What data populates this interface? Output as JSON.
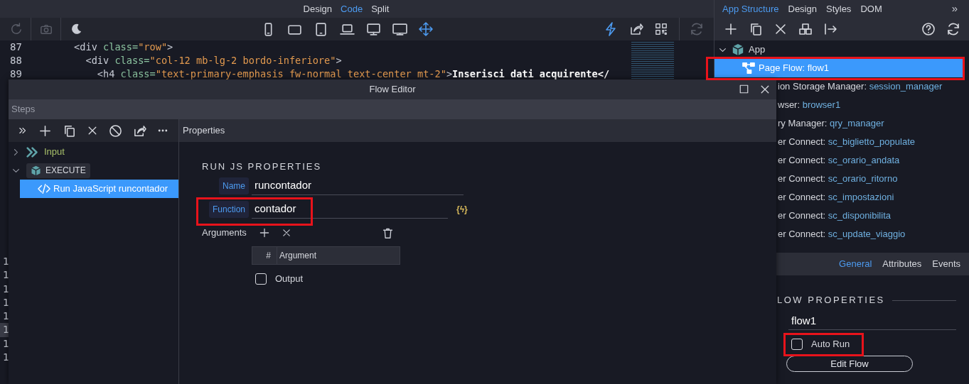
{
  "top_tabs": [
    {
      "label": "Design",
      "selected": false
    },
    {
      "label": "Code",
      "selected": true
    },
    {
      "label": "Split",
      "selected": false
    }
  ],
  "code_editor": {
    "lines": [
      {
        "number": "87",
        "tokens": [
          {
            "kind": "tag",
            "text": "      <div"
          },
          {
            "kind": "attr",
            "text": " class="
          },
          {
            "kind": "string",
            "text": "\"row\""
          },
          {
            "kind": "tag",
            "text": ">"
          }
        ]
      },
      {
        "number": "88",
        "tokens": [
          {
            "kind": "tag",
            "text": "        <div"
          },
          {
            "kind": "attr",
            "text": " class="
          },
          {
            "kind": "string",
            "text": "\"col-12 mb-lg-2 bordo-inferiore\""
          },
          {
            "kind": "tag",
            "text": ">"
          }
        ]
      },
      {
        "number": "89",
        "tokens": [
          {
            "kind": "tag",
            "text": "          <h4"
          },
          {
            "kind": "attr",
            "text": " class="
          },
          {
            "kind": "string",
            "text": "\"text-primary-emphasis fw-normal text-center mt-2\""
          },
          {
            "kind": "tag",
            "text": ">"
          },
          {
            "kind": "text",
            "text": "Inserisci dati acquirente</"
          }
        ]
      }
    ],
    "gutter_fragments": [
      {
        "text": "1",
        "current": false
      },
      {
        "text": "1",
        "current": false
      },
      {
        "text": "1",
        "current": false
      },
      {
        "text": "1",
        "current": false
      },
      {
        "text": "1",
        "current": false
      },
      {
        "text": "1",
        "current": true
      },
      {
        "text": "1",
        "current": false
      },
      {
        "text": "1",
        "current": false
      }
    ]
  },
  "structure_panel": {
    "tabs": [
      {
        "label": "App Structure",
        "selected": true
      },
      {
        "label": "Design",
        "selected": false
      },
      {
        "label": "Styles",
        "selected": false
      },
      {
        "label": "DOM",
        "selected": false
      }
    ],
    "more": "»",
    "tree": {
      "label": "App",
      "expanded": true,
      "children": [
        {
          "kind": "page_flow",
          "label": "Page Flow:",
          "value": "flow1",
          "selected": true
        },
        {
          "kind": "component",
          "label": "ion Storage Manager:",
          "value": "session_manager",
          "selected": false
        },
        {
          "kind": "component",
          "label": "wser:",
          "value": "browser1",
          "selected": false
        },
        {
          "kind": "component",
          "label": "ry Manager:",
          "value": "qry_manager",
          "selected": false
        },
        {
          "kind": "component",
          "label": "er Connect:",
          "value": "sc_biglietto_populate",
          "selected": false
        },
        {
          "kind": "component",
          "label": "er Connect:",
          "value": "sc_orario_andata",
          "selected": false
        },
        {
          "kind": "component",
          "label": "er Connect:",
          "value": "sc_orario_ritorno",
          "selected": false
        },
        {
          "kind": "component",
          "label": "er Connect:",
          "value": "sc_impostazioni",
          "selected": false
        },
        {
          "kind": "component",
          "label": "er Connect:",
          "value": "sc_disponibilita",
          "selected": false
        },
        {
          "kind": "component",
          "label": "er Connect:",
          "value": "sc_update_viaggio",
          "selected": false
        }
      ]
    }
  },
  "properties_panel": {
    "tabs": [
      {
        "label": "General",
        "selected": true
      },
      {
        "label": "Attributes",
        "selected": false
      },
      {
        "label": "Events",
        "selected": false
      }
    ],
    "section_title": "LOW PROPERTIES",
    "id_value": "flow1",
    "auto_run": {
      "label": "Auto Run",
      "checked": false
    },
    "edit_button": "Edit Flow"
  },
  "flow_editor": {
    "title": "Flow Editor",
    "steps": {
      "header": "Steps",
      "tree": [
        {
          "kind": "input",
          "label": "Input",
          "expanded": false,
          "selected": false
        },
        {
          "kind": "execute",
          "label": "EXECUTE",
          "expanded": true,
          "selected": false,
          "children": [
            {
              "kind": "javascript",
              "label": "Run JavaScript runcontador",
              "selected": true
            }
          ]
        }
      ]
    },
    "properties": {
      "header": "Properties",
      "section_title": "RUN JS PROPERTIES",
      "fields": [
        {
          "label": "Name",
          "value": "runcontador"
        },
        {
          "label": "Function",
          "value": "contador"
        }
      ],
      "function_icon": "{ϟ}",
      "arguments": {
        "label": "Arguments",
        "columns": [
          "#",
          "Argument"
        ]
      },
      "output": {
        "label": "Output",
        "checked": false
      }
    }
  }
}
